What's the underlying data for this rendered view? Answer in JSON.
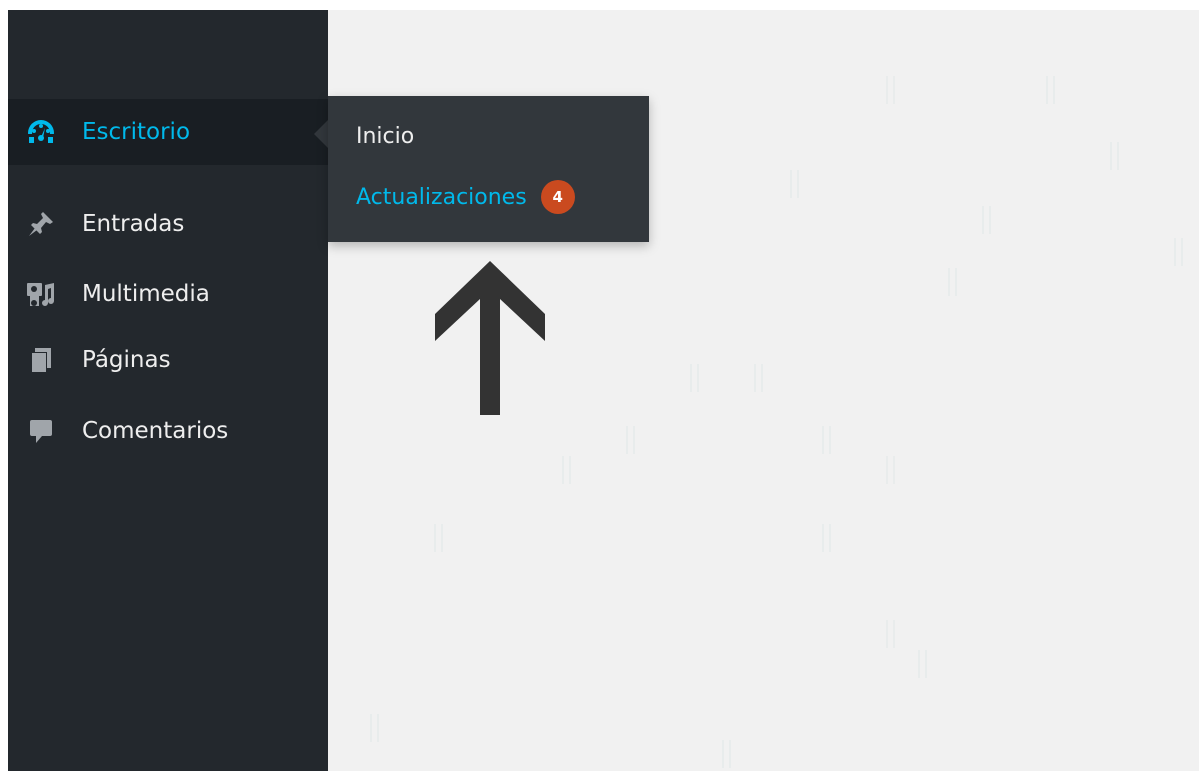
{
  "sidebar": {
    "items": [
      {
        "label": "Escritorio",
        "icon": "dashboard-icon",
        "current": true
      },
      {
        "label": "Entradas",
        "icon": "pushpin-icon"
      },
      {
        "label": "Multimedia",
        "icon": "media-icon"
      },
      {
        "label": "Páginas",
        "icon": "pages-icon"
      },
      {
        "label": "Comentarios",
        "icon": "comments-icon"
      }
    ]
  },
  "flyout": {
    "items": [
      {
        "label": "Inicio"
      },
      {
        "label": "Actualizaciones",
        "badge": "4"
      }
    ]
  },
  "colors": {
    "sidebar_bg": "#23282d",
    "current_bg": "#191e23",
    "accent": "#00b9eb",
    "flyout_bg": "#32373c",
    "badge_bg": "#ca4a1f",
    "content_bg": "#f1f1f1",
    "arrow": "#333333"
  },
  "annotation": {
    "icon": "up-arrow-icon"
  }
}
